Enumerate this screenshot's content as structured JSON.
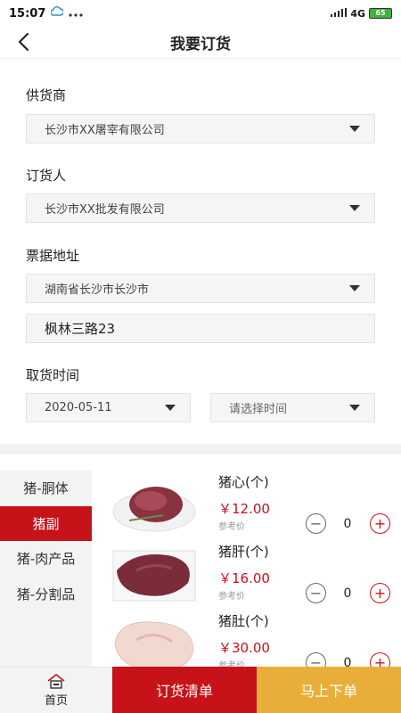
{
  "status_bar": {
    "time": "15:07",
    "icons": [
      "cloud-icon",
      "more-dots-icon"
    ],
    "network": "4G",
    "battery": "65"
  },
  "header": {
    "title": "我要订货",
    "back_icon": "chevron-left-icon"
  },
  "form": {
    "supplier": {
      "label": "供货商",
      "value": "长沙市XX屠宰有限公司"
    },
    "orderer": {
      "label": "订货人",
      "value": "长沙市XX批发有限公司"
    },
    "invoice_address": {
      "label": "票据地址",
      "region": "湖南省长沙市长沙市",
      "detail": "枫林三路23"
    },
    "pickup_time": {
      "label": "取货时间",
      "date": "2020-05-11",
      "time_placeholder": "请选择时间"
    }
  },
  "categories": [
    {
      "label": "猪-胴体",
      "active": false
    },
    {
      "label": "猪副",
      "active": true
    },
    {
      "label": "猪-肉产品",
      "active": false
    },
    {
      "label": "猪-分割品",
      "active": false
    }
  ],
  "products": [
    {
      "name": "猪心(个)",
      "price": "￥12.00",
      "ref": "参考价",
      "qty": "0"
    },
    {
      "name": "猪肝(个)",
      "price": "￥16.00",
      "ref": "参考价",
      "qty": "0"
    },
    {
      "name": "猪肚(个)",
      "price": "￥30.00",
      "ref": "参考价",
      "qty": "0"
    }
  ],
  "qty_controls": {
    "minus": "−",
    "plus": "+"
  },
  "bottom": {
    "home": "首页",
    "order_list": "订货清单",
    "place_order": "马上下单"
  },
  "colors": {
    "accent": "#c81219",
    "order_button": "#e9ae3a"
  }
}
